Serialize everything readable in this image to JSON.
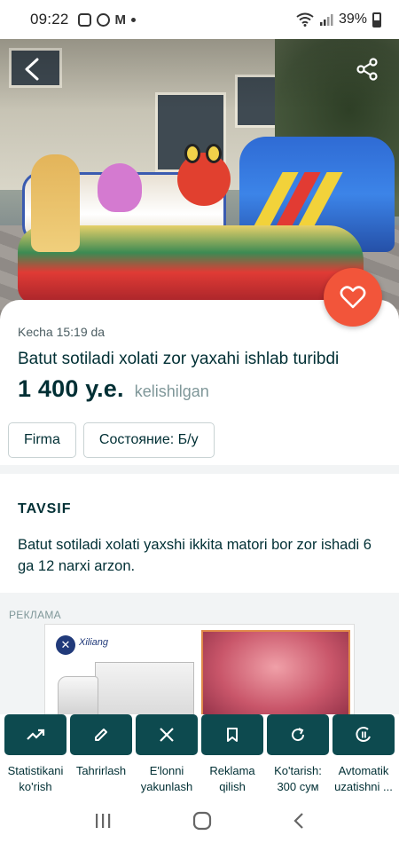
{
  "status_bar": {
    "time": "09:22",
    "battery": "39%",
    "icons": [
      "instagram-icon",
      "messenger-icon",
      "gmail-icon",
      "dot-icon",
      "wifi-icon",
      "signal-icon",
      "battery-icon"
    ]
  },
  "header": {
    "back_icon": "arrow-back-icon",
    "share_icon": "share-icon",
    "favorite_icon": "heart-icon"
  },
  "listing": {
    "date": "Kecha 15:19 da",
    "title": "Batut sotiladi xolati zor yaxahi ishlab turibdi",
    "price": "1 400 у.е.",
    "price_note": "kelishilgan",
    "tags": [
      "Firma",
      "Состояние: Б/у"
    ]
  },
  "description": {
    "heading": "TAVSIF",
    "text": "Batut sotiladi xolati yaxshi ikkita matori bor zor ishadi 6 ga 12 narxi arzon."
  },
  "ad": {
    "label": "РЕКЛАМА",
    "brand_logo": "✕",
    "brand_name": "Xiliang"
  },
  "actions": [
    {
      "label": "Statistikani ko'rish",
      "icon": "trending-up-icon"
    },
    {
      "label": "Tahrirlash",
      "icon": "pencil-icon"
    },
    {
      "label": "E'lonni yakunlash",
      "icon": "close-icon"
    },
    {
      "label": "Reklama qilish",
      "icon": "bookmark-icon"
    },
    {
      "label": "Ko'tarish: 300 сум",
      "icon": "refresh-icon"
    },
    {
      "label": "Avtomatik uzatishni ...",
      "icon": "auto-renew-icon"
    }
  ],
  "colors": {
    "primary_dark": "#002f34",
    "action_button": "#0d4a4f",
    "favorite": "#f2553a",
    "muted": "#7f9799"
  }
}
